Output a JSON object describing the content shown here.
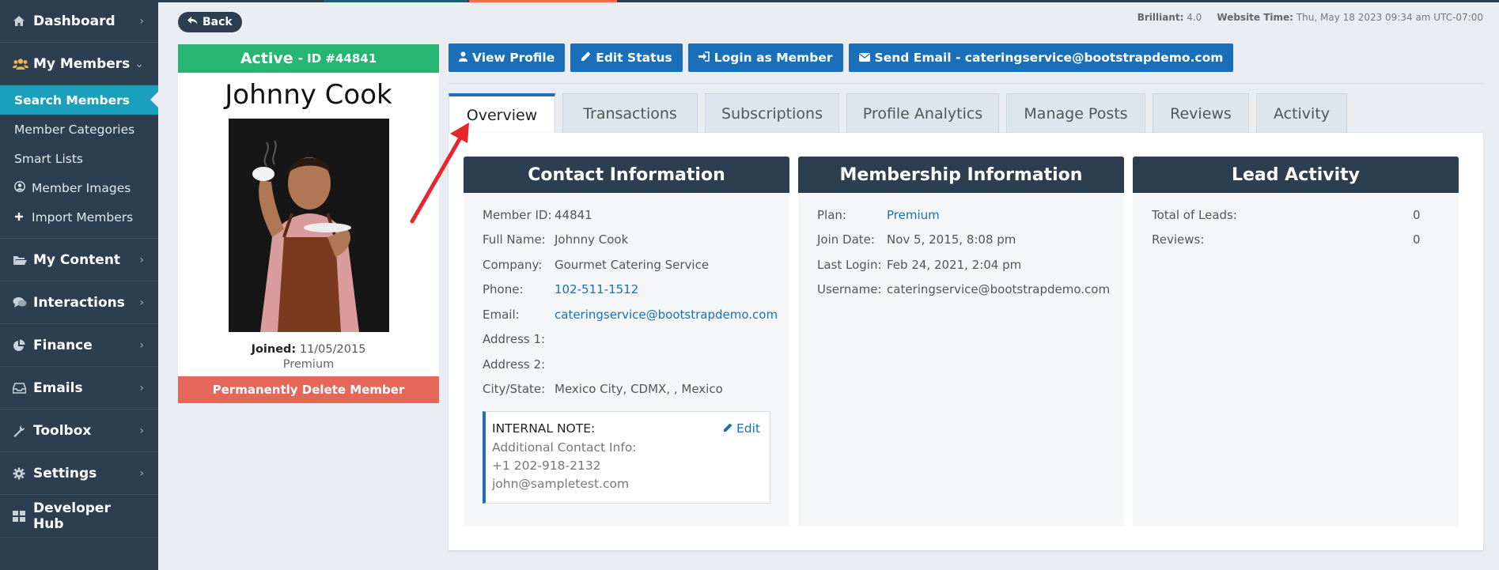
{
  "sidebar": {
    "items": [
      {
        "icon": "home-icon",
        "label": "Dashboard"
      },
      {
        "icon": "users-icon",
        "label": "My Members"
      },
      {
        "icon": "folder-icon",
        "label": "My Content"
      },
      {
        "icon": "chat-icon",
        "label": "Interactions"
      },
      {
        "icon": "pie-chart-icon",
        "label": "Finance"
      },
      {
        "icon": "inbox-icon",
        "label": "Emails"
      },
      {
        "icon": "wrench-icon",
        "label": "Toolbox"
      },
      {
        "icon": "gear-icon",
        "label": "Settings"
      },
      {
        "icon": "grid-icon",
        "label": "Developer Hub"
      }
    ],
    "members_sub": [
      "Search Members",
      "Member Categories",
      "Smart Lists",
      "Member Images",
      "Import Members"
    ]
  },
  "header": {
    "back_label": "Back",
    "version_label": "Brilliant:",
    "version_value": "4.0",
    "time_label": "Website Time:",
    "time_value": "Thu, May 18 2023 09:34 am UTC-07:00"
  },
  "profile": {
    "status": "Active",
    "id_label": "- ID #44841",
    "name": "Johnny Cook",
    "joined_label": "Joined:",
    "joined_value": "11/05/2015",
    "plan": "Premium",
    "delete_label": "Permanently Delete Member"
  },
  "actions": {
    "view_profile": "View Profile",
    "edit_status": "Edit Status",
    "login_as": "Login as Member",
    "send_email": "Send Email - cateringservice@bootstrapdemo.com"
  },
  "tabs": [
    "Overview",
    "Transactions",
    "Subscriptions",
    "Profile Analytics",
    "Manage Posts",
    "Reviews",
    "Activity"
  ],
  "contact": {
    "title": "Contact Information",
    "rows": [
      {
        "k": "Member ID:",
        "v": "44841"
      },
      {
        "k": "Full Name:",
        "v": "Johnny Cook"
      },
      {
        "k": "Company:",
        "v": "Gourmet Catering Service"
      },
      {
        "k": "Phone:",
        "v": "102-511-1512"
      },
      {
        "k": "Email:",
        "v": "cateringservice@bootstrapdemo.com"
      },
      {
        "k": "Address 1:",
        "v": ""
      },
      {
        "k": "Address 2:",
        "v": ""
      },
      {
        "k": "City/State:",
        "v": "Mexico City, CDMX, , Mexico"
      }
    ],
    "note": {
      "title": "INTERNAL NOTE:",
      "edit": "Edit",
      "lines": [
        "Additional Contact Info:",
        "+1 202-918-2132",
        "john@sampletest.com"
      ]
    }
  },
  "membership": {
    "title": "Membership Information",
    "rows": [
      {
        "k": "Plan:",
        "v": "Premium"
      },
      {
        "k": "Join Date:",
        "v": "Nov 5, 2015, 8:08 pm"
      },
      {
        "k": "Last Login:",
        "v": "Feb 24, 2021, 2:04 pm"
      },
      {
        "k": "Username:",
        "v": "cateringservice@bootstrapdemo.com"
      }
    ]
  },
  "lead": {
    "title": "Lead Activity",
    "rows": [
      {
        "k": "Total of Leads:",
        "v": "0"
      },
      {
        "k": "Reviews:",
        "v": "0"
      }
    ]
  },
  "colors": {
    "sidebar": "#2c3e50",
    "accent": "#1a6fb8",
    "active_sub": "#1a9fbd",
    "status_green": "#27b574",
    "delete_red": "#e4675a",
    "arrow_red": "#e8262b"
  }
}
